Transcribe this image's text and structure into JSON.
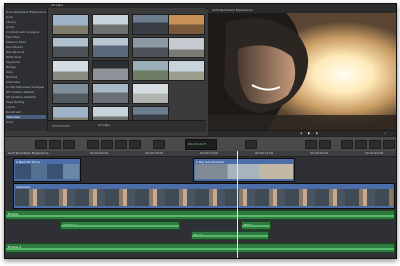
{
  "colors": {
    "accent": "#4a5f80",
    "clip_blue": "#4b6da8",
    "audio_green": "#2f7a3e",
    "playhead": "#e8e8e8"
  },
  "browser": {
    "header_left": "All Clips",
    "header_right": "",
    "footer_label": "All Clips"
  },
  "sidebar": {
    "items": [
      {
        "label": "Audi Sportback Experience"
      },
      {
        "label": "Audi"
      },
      {
        "label": "Library"
      },
      {
        "label": "Audio"
      },
      {
        "label": "Content Auto Analysis"
      },
      {
        "label": "Favorites"
      },
      {
        "label": "Medium Shot"
      },
      {
        "label": "One Person"
      },
      {
        "label": "Two Persons"
      },
      {
        "label": "Wide Shot"
      },
      {
        "label": "Keywords"
      },
      {
        "label": "Bridge"
      },
      {
        "label": "Cars"
      },
      {
        "label": "Helmet"
      },
      {
        "label": "Interview"
      },
      {
        "label": "In Clip Narrative Vintages"
      },
      {
        "label": "IW Clusters Details"
      },
      {
        "label": "IW Clusters Outside"
      },
      {
        "label": "Keep Rolling"
      },
      {
        "label": "Lunch"
      },
      {
        "label": "Racetrack"
      },
      {
        "label": "Interview"
      },
      {
        "label": "Audi"
      }
    ],
    "selected_index": 21
  },
  "viewer": {
    "title": "Audi Sportback Experience",
    "timecode": "00:00:14:07"
  },
  "toolbar": {
    "timecode": "00:00:14:07"
  },
  "timeline": {
    "project_title": "Audi Sportback Experience",
    "ruler_labels": [
      "00:00:00:00",
      "00:00:05:00",
      "00:00:10:00",
      "00:00:15:00",
      "00:00:20:00",
      "00:00:25:00"
    ],
    "clips": {
      "upper_left": "A New Ski Drive",
      "upper_right": "A Big Get Overlaid",
      "primary": "Interview"
    },
    "audio": {
      "a1": "Engine",
      "a2": "Ambience",
      "a3": "Wind",
      "a4": "Music",
      "a5": "Engine 2"
    }
  }
}
